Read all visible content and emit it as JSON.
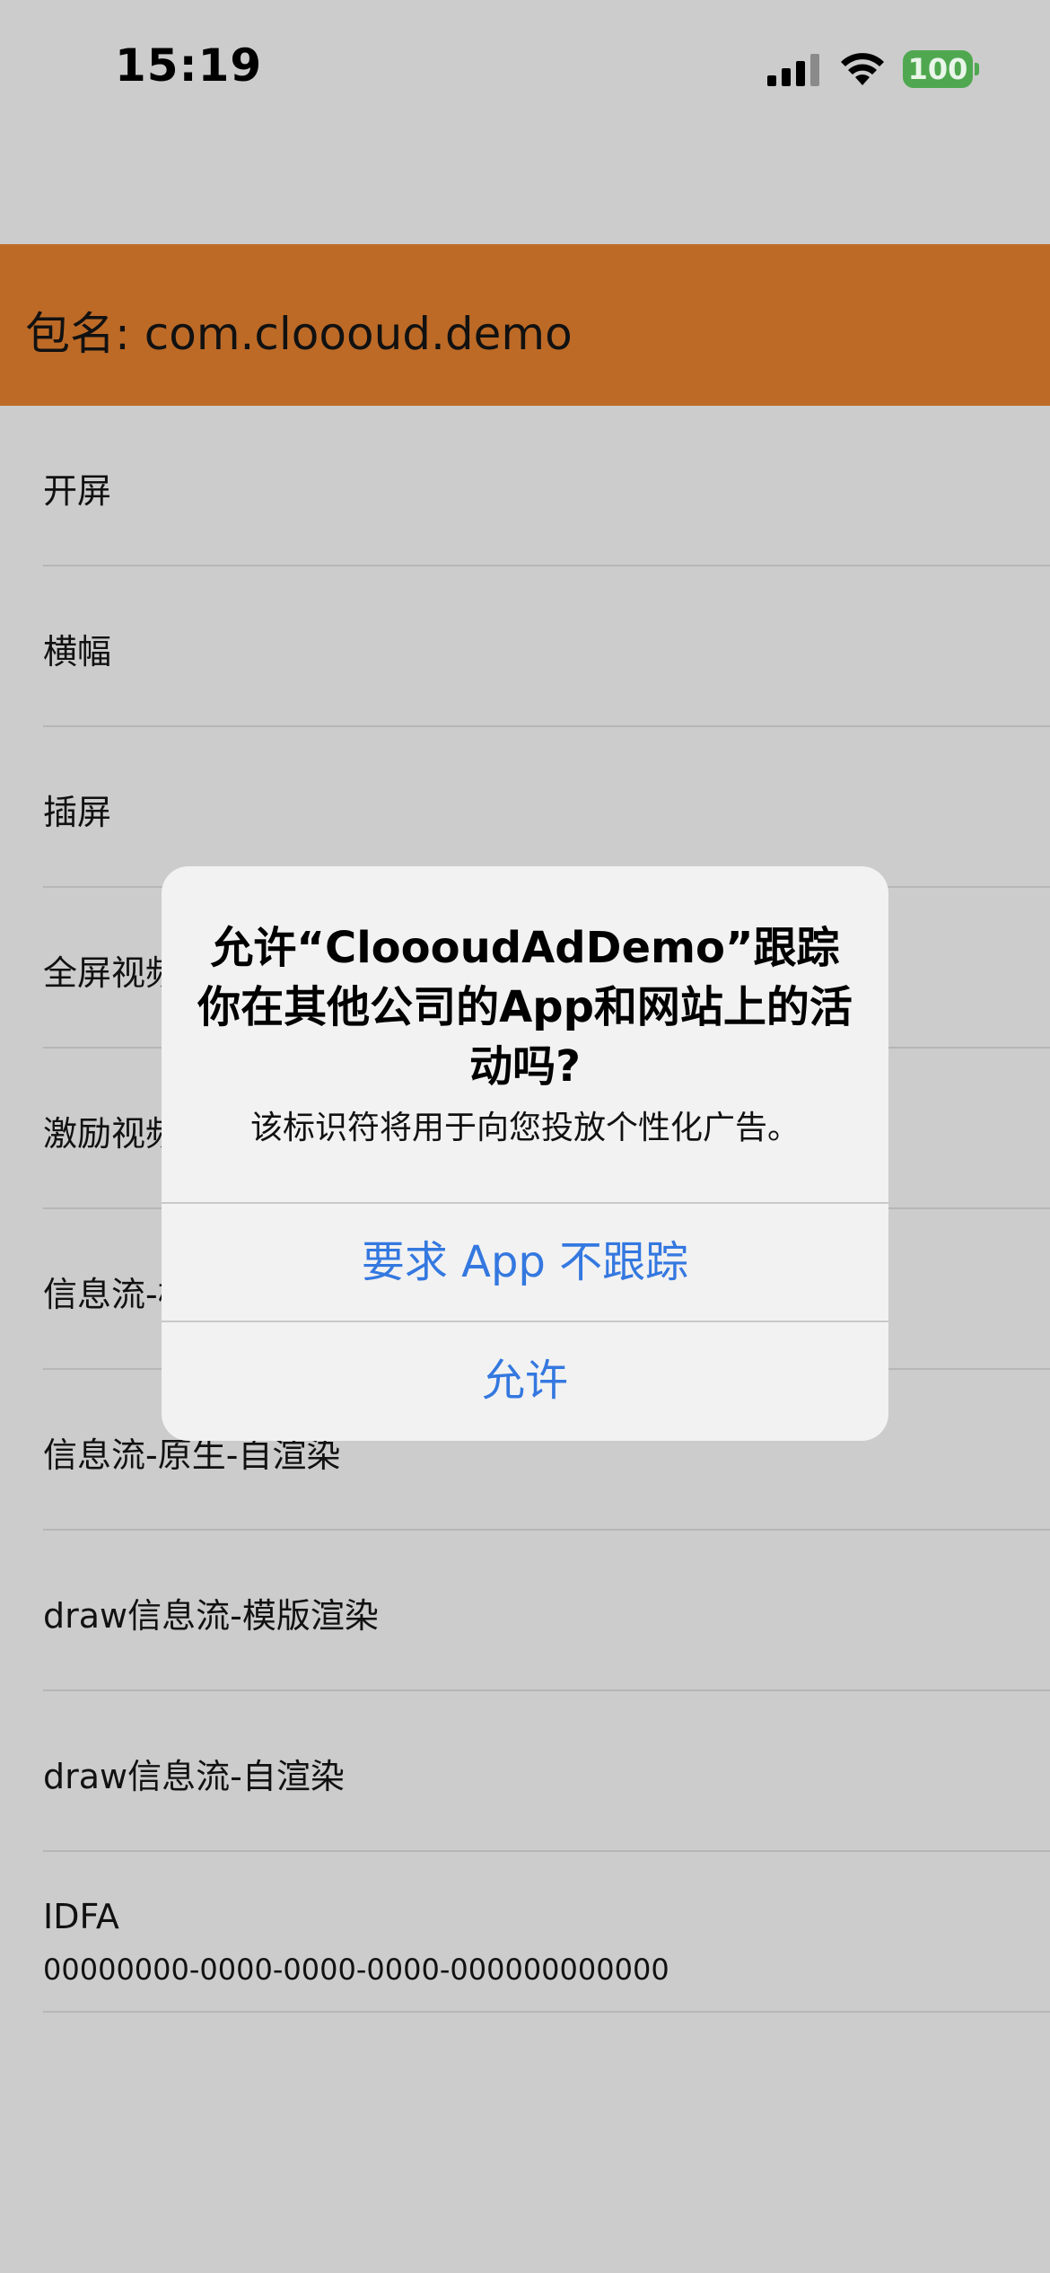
{
  "status_bar": {
    "time": "15:19",
    "battery_level": "100",
    "icons": [
      "signal-bars-icon",
      "wifi-icon",
      "battery-icon"
    ],
    "battery_color": "#4fa84f"
  },
  "header": {
    "title": "包名: com.cloooud.demo",
    "background": "#bd6a27"
  },
  "menu": {
    "items": [
      {
        "label": "开屏"
      },
      {
        "label": "横幅"
      },
      {
        "label": "插屏"
      },
      {
        "label": "全屏视频"
      },
      {
        "label": "激励视频"
      },
      {
        "label": "信息流-模版渲染"
      },
      {
        "label": "信息流-原生-自渲染"
      },
      {
        "label": "draw信息流-模版渲染"
      },
      {
        "label": "draw信息流-自渲染"
      }
    ],
    "idfa": {
      "label": "IDFA",
      "value": "00000000-0000-0000-0000-000000000000"
    }
  },
  "alert": {
    "title": "允许“CloooudAdDemo”跟踪你在其他公司的App和网站上的活动吗?",
    "message": "该标识符将用于向您投放个性化广告。",
    "button_deny": "要求 App 不跟踪",
    "button_allow": "允许",
    "button_color": "#3478e0"
  }
}
